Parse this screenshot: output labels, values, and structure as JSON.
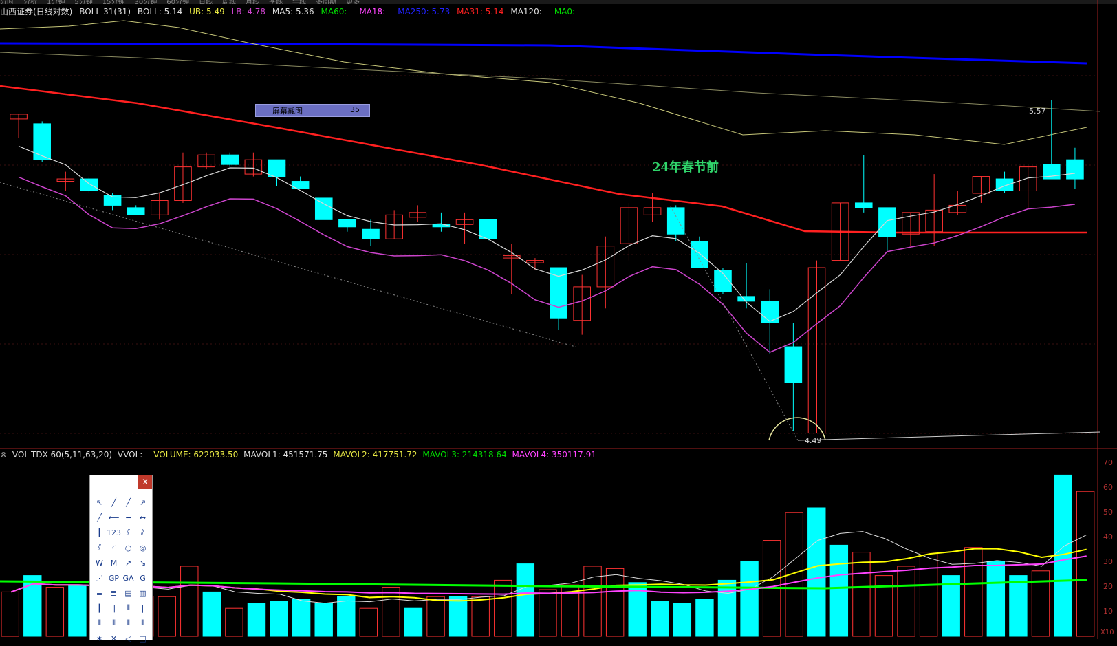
{
  "topbar": [
    "分时",
    "分析",
    "1分钟",
    "5分钟",
    "15分钟",
    "30分钟",
    "60分钟",
    "日线",
    "周线",
    "月线",
    "季线",
    "年线",
    "多周期",
    "更多"
  ],
  "price_header": {
    "stock": "山西证券(日线对数)",
    "indicator": "BOLL-31(31)",
    "boll": "BOLL: 5.14",
    "ub": "UB: 5.49",
    "lb": "LB: 4.78",
    "ma5": "MA5: 5.36",
    "ma60": "MA60: -",
    "ma18": "MA18: -",
    "ma250": "MA250: 5.73",
    "ma31": "MA31: 5.14",
    "ma120": "MA120: -",
    "ma0": "MA0: -"
  },
  "vol_header": {
    "indicator": "VOL-TDX-60(5,11,63,20)",
    "vvol": "VVOL: -",
    "volume": "VOLUME: 622033.50",
    "mavol1": "MAVOL1: 451571.75",
    "mavol2": "MAVOL2: 417751.72",
    "mavol3": "MAVOL3: 214318.64",
    "mavol4": "MAVOL4: 350117.91"
  },
  "screenshot_tip": {
    "label": "屏幕截图",
    "value": "35"
  },
  "annotation": "24年春节前",
  "price_high_label": "5.57",
  "price_low_label": "4.49",
  "vol_axis": [
    "70",
    "60",
    "50",
    "40",
    "30",
    "20",
    "10"
  ],
  "vol_unit": "X10",
  "colors": {
    "up": "#ff3232",
    "down": "#00ffff",
    "ma250": "#0000ff",
    "ma31": "#ff2020",
    "mb": "#d8d8d8",
    "lb": "#cc44cc",
    "ub": "#c8c87a",
    "green": "#00ff00",
    "yellow": "#ffff00"
  },
  "toolbox": {
    "close": "x",
    "tools": [
      "cursor-icon",
      "line-icon",
      "ray-icon",
      "arrow-line-icon",
      "segment-icon",
      "h-ray-icon",
      "h-line-icon",
      "h-segment-icon",
      "v-line-icon",
      "text-123-icon",
      "parallel-icon",
      "channel-icon",
      "trend-icon",
      "arc-icon",
      "circle-icon",
      "ellipse-icon",
      "wave-w-icon",
      "wave-m-icon",
      "wave-up-icon",
      "wave-down-icon",
      "fan-icon",
      "gp-icon",
      "ga-icon",
      "gc-icon",
      "fib-icon",
      "fib-text-icon",
      "gann-icon",
      "gann-fan-icon",
      "cycle-icon",
      "cycle-2-icon",
      "cycle-3-icon",
      "period-icon",
      "bars-icon",
      "bars-2-icon",
      "bars-3-icon",
      "bars-4-icon",
      "star-icon",
      "cross-icon",
      "triangle-icon",
      "rect-icon"
    ]
  },
  "chart_data": {
    "type": "candlestick",
    "candles": [
      {
        "o": 5.34,
        "c": 5.36,
        "h": 5.36,
        "l": 5.26
      },
      {
        "o": 5.32,
        "c": 5.17,
        "h": 5.33,
        "l": 5.16
      },
      {
        "o": 5.08,
        "c": 5.09,
        "h": 5.12,
        "l": 5.04
      },
      {
        "o": 5.09,
        "c": 5.04,
        "h": 5.1,
        "l": 5.03
      },
      {
        "o": 5.02,
        "c": 4.98,
        "h": 5.03,
        "l": 4.96
      },
      {
        "o": 4.97,
        "c": 4.94,
        "h": 4.98,
        "l": 4.94
      },
      {
        "o": 4.94,
        "c": 5.0,
        "h": 5.03,
        "l": 4.92
      },
      {
        "o": 5.0,
        "c": 5.14,
        "h": 5.2,
        "l": 4.99
      },
      {
        "o": 5.14,
        "c": 5.19,
        "h": 5.2,
        "l": 5.13
      },
      {
        "o": 5.19,
        "c": 5.15,
        "h": 5.2,
        "l": 5.14
      },
      {
        "o": 5.11,
        "c": 5.17,
        "h": 5.2,
        "l": 5.1
      },
      {
        "o": 5.17,
        "c": 5.1,
        "h": 5.17,
        "l": 5.06
      },
      {
        "o": 5.08,
        "c": 5.05,
        "h": 5.1,
        "l": 5.05
      },
      {
        "o": 5.01,
        "c": 4.92,
        "h": 5.01,
        "l": 4.92
      },
      {
        "o": 4.92,
        "c": 4.89,
        "h": 4.92,
        "l": 4.87
      },
      {
        "o": 4.88,
        "c": 4.84,
        "h": 4.92,
        "l": 4.81
      },
      {
        "o": 4.84,
        "c": 4.94,
        "h": 4.96,
        "l": 4.84
      },
      {
        "o": 4.93,
        "c": 4.95,
        "h": 4.98,
        "l": 4.91
      },
      {
        "o": 4.9,
        "c": 4.89,
        "h": 4.95,
        "l": 4.87
      },
      {
        "o": 4.9,
        "c": 4.92,
        "h": 4.95,
        "l": 4.82
      },
      {
        "o": 4.92,
        "c": 4.84,
        "h": 4.92,
        "l": 4.83
      },
      {
        "o": 4.76,
        "c": 4.77,
        "h": 4.82,
        "l": 4.61
      },
      {
        "o": 4.74,
        "c": 4.75,
        "h": 4.76,
        "l": 4.71
      },
      {
        "o": 4.72,
        "c": 4.51,
        "h": 4.72,
        "l": 4.46
      },
      {
        "o": 4.5,
        "c": 4.64,
        "h": 4.69,
        "l": 4.44
      },
      {
        "o": 4.64,
        "c": 4.81,
        "h": 4.85,
        "l": 4.55
      },
      {
        "o": 4.82,
        "c": 4.97,
        "h": 4.99,
        "l": 4.75
      },
      {
        "o": 4.94,
        "c": 4.97,
        "h": 5.03,
        "l": 4.91
      },
      {
        "o": 4.97,
        "c": 4.86,
        "h": 4.98,
        "l": 4.83
      },
      {
        "o": 4.83,
        "c": 4.72,
        "h": 4.85,
        "l": 4.72
      },
      {
        "o": 4.71,
        "c": 4.62,
        "h": 4.72,
        "l": 4.61
      },
      {
        "o": 4.6,
        "c": 4.58,
        "h": 4.74,
        "l": 4.55
      },
      {
        "o": 4.58,
        "c": 4.49,
        "h": 4.63,
        "l": 4.36
      },
      {
        "o": 4.39,
        "c": 4.24,
        "h": 4.49,
        "l": 4.04
      },
      {
        "o": 4.03,
        "c": 4.72,
        "h": 4.75,
        "l": 4.03
      },
      {
        "o": 4.75,
        "c": 4.99,
        "h": 4.99,
        "l": 4.75
      },
      {
        "o": 4.99,
        "c": 4.97,
        "h": 5.19,
        "l": 4.95
      },
      {
        "o": 4.97,
        "c": 4.85,
        "h": 4.97,
        "l": 4.79
      },
      {
        "o": 4.86,
        "c": 4.95,
        "h": 4.95,
        "l": 4.81
      },
      {
        "o": 4.87,
        "c": 4.96,
        "h": 5.11,
        "l": 4.81
      },
      {
        "o": 4.95,
        "c": 4.98,
        "h": 5.04,
        "l": 4.94
      },
      {
        "o": 5.03,
        "c": 5.1,
        "h": 5.1,
        "l": 4.99
      },
      {
        "o": 5.09,
        "c": 5.04,
        "h": 5.12,
        "l": 5.03
      },
      {
        "o": 5.04,
        "c": 5.14,
        "h": 5.14,
        "l": 4.97
      },
      {
        "o": 5.15,
        "c": 5.09,
        "h": 5.42,
        "l": 5.09
      },
      {
        "o": 5.17,
        "c": 5.09,
        "h": 5.22,
        "l": 5.05
      }
    ],
    "volume": [
      19,
      26,
      21,
      22,
      20,
      25,
      17,
      17,
      30,
      19,
      12,
      14,
      15,
      16,
      14,
      17,
      12,
      21,
      12,
      17,
      17,
      17,
      24,
      31,
      20,
      22,
      30,
      29,
      23,
      15,
      14,
      16,
      24,
      32,
      41,
      53,
      55,
      39,
      36,
      26,
      30,
      36,
      26,
      38,
      32,
      26,
      28,
      69,
      62
    ],
    "price_range": [
      4.0,
      5.75
    ],
    "vol_range": [
      0,
      75
    ]
  }
}
